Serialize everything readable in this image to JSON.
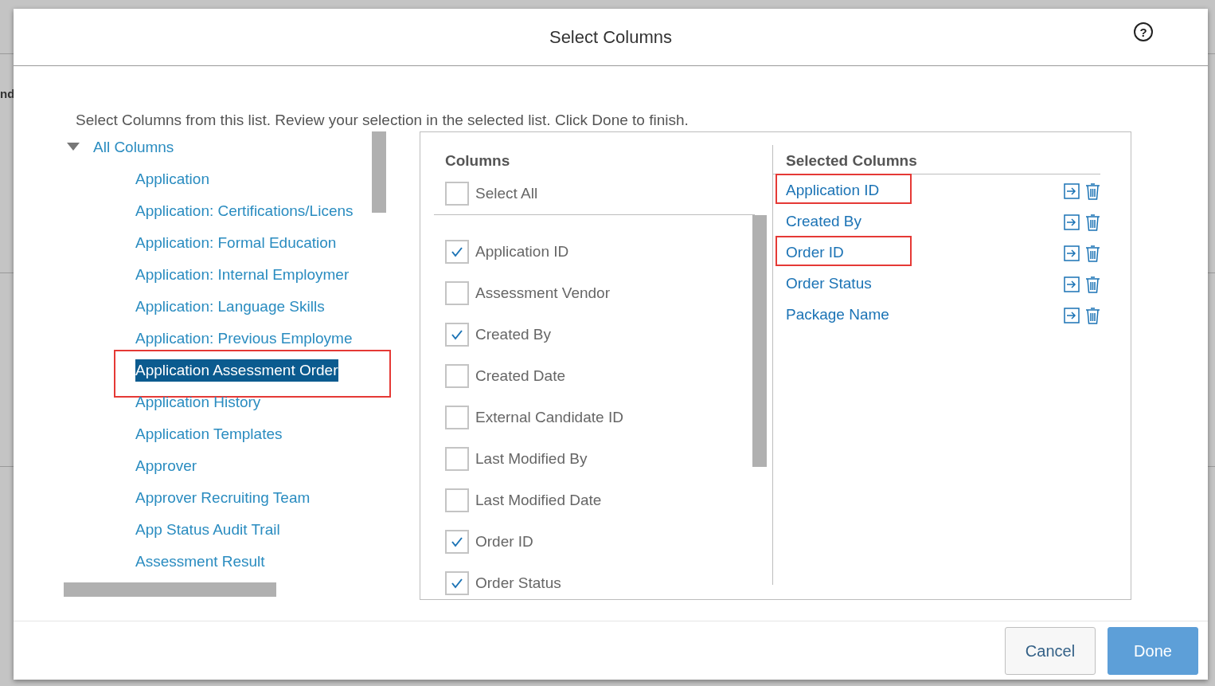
{
  "background": {
    "text": "nd"
  },
  "dialog": {
    "title": "Select Columns",
    "help": "?"
  },
  "instruction": "Select Columns from this list. Review your selection in the selected list. Click Done to finish.",
  "tree": {
    "label": "All Columns",
    "expanded": true,
    "children": [
      {
        "label": "Application",
        "selected": false,
        "annotated": false
      },
      {
        "label": "Application: Certifications/Licens",
        "selected": false,
        "annotated": false
      },
      {
        "label": "Application: Formal Education",
        "selected": false,
        "annotated": false
      },
      {
        "label": "Application: Internal Employmer",
        "selected": false,
        "annotated": false
      },
      {
        "label": "Application: Language Skills",
        "selected": false,
        "annotated": false
      },
      {
        "label": "Application: Previous Employme",
        "selected": false,
        "annotated": false
      },
      {
        "label": "Application Assessment Order",
        "selected": true,
        "annotated": true
      },
      {
        "label": "Application History",
        "selected": false,
        "annotated": false
      },
      {
        "label": "Application Templates",
        "selected": false,
        "annotated": false
      },
      {
        "label": "Approver",
        "selected": false,
        "annotated": false
      },
      {
        "label": "Approver Recruiting Team",
        "selected": false,
        "annotated": false
      },
      {
        "label": "App Status Audit Trail",
        "selected": false,
        "annotated": false
      },
      {
        "label": "Assessment Result",
        "selected": false,
        "annotated": false
      }
    ]
  },
  "columns": {
    "heading": "Columns",
    "select_all": {
      "label": "Select All",
      "checked": false
    },
    "items": [
      {
        "label": "Application ID",
        "checked": true
      },
      {
        "label": "Assessment Vendor",
        "checked": false
      },
      {
        "label": "Created By",
        "checked": true
      },
      {
        "label": "Created Date",
        "checked": false
      },
      {
        "label": "External Candidate ID",
        "checked": false
      },
      {
        "label": "Last Modified By",
        "checked": false
      },
      {
        "label": "Last Modified Date",
        "checked": false
      },
      {
        "label": "Order ID",
        "checked": true
      },
      {
        "label": "Order Status",
        "checked": true
      }
    ]
  },
  "selected_columns": {
    "heading": "Selected Columns",
    "items": [
      {
        "label": "Application ID",
        "annotated": true
      },
      {
        "label": "Created By",
        "annotated": false
      },
      {
        "label": "Order ID",
        "annotated": true
      },
      {
        "label": "Order Status",
        "annotated": false
      },
      {
        "label": "Package Name",
        "annotated": false
      }
    ]
  },
  "buttons": [
    {
      "label": "Cancel",
      "kind": "secondary"
    },
    {
      "label": "Done",
      "kind": "primary"
    }
  ]
}
